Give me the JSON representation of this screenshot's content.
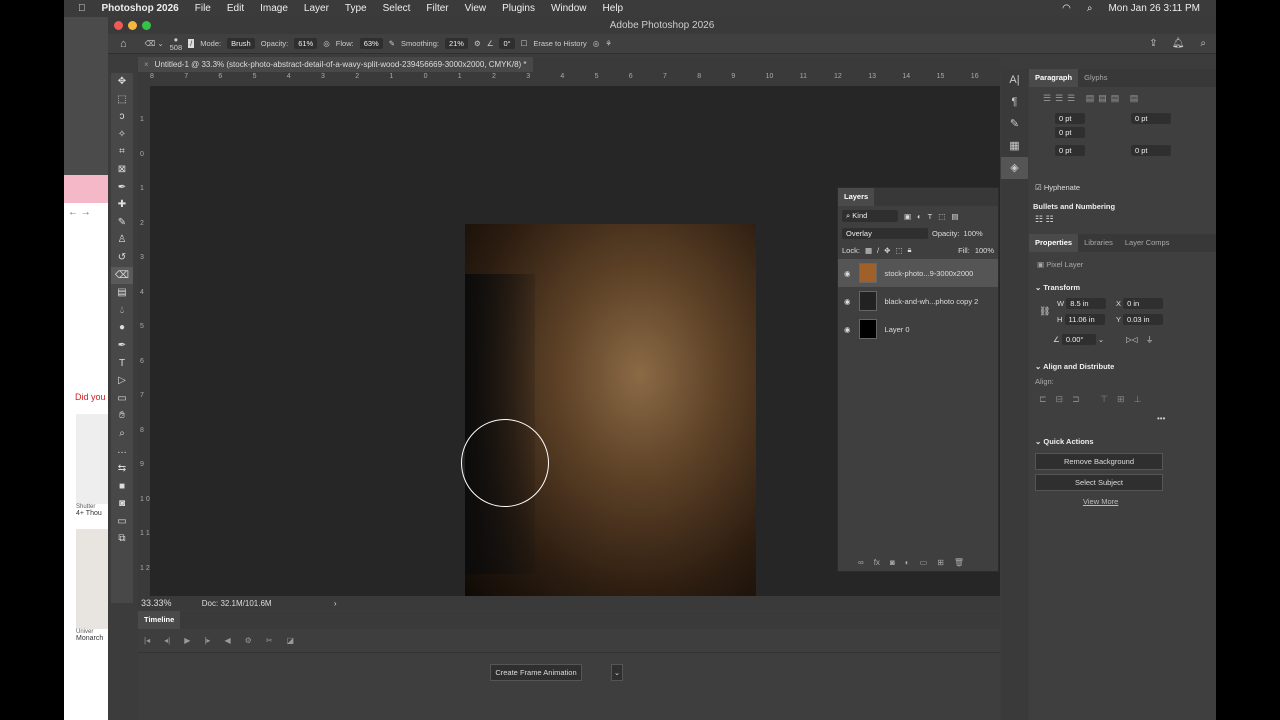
{
  "menubar": {
    "app": "Photoshop 2026",
    "items": [
      "File",
      "Edit",
      "Image",
      "Layer",
      "Type",
      "Select",
      "Filter",
      "View",
      "Plugins",
      "Window",
      "Help"
    ],
    "clock": "Mon Jan 26  3:11 PM"
  },
  "window": {
    "title": "Adobe Photoshop 2026"
  },
  "options": {
    "brush_size": "508",
    "mode_label": "Mode:",
    "mode": "Brush",
    "opacity_label": "Opacity:",
    "opacity": "61%",
    "flow_label": "Flow:",
    "flow": "63%",
    "smoothing_label": "Smoothing:",
    "smoothing": "21%",
    "angle": "0°",
    "erase_history": "Erase to History"
  },
  "document": {
    "tab": "Untitled-1 @ 33.3% (stock-photo-abstract-detail-of-a-wavy-split-wood-239456669-3000x2000, CMYK/8) *",
    "zoom": "33.33%",
    "doc_size": "Doc: 32.1M/101.6M"
  },
  "ruler": {
    "h": [
      "8",
      "7",
      "6",
      "5",
      "4",
      "3",
      "2",
      "1",
      "0",
      "1",
      "2",
      "3",
      "4",
      "5",
      "6",
      "7",
      "8",
      "9",
      "10",
      "11",
      "12",
      "13",
      "14",
      "15",
      "16"
    ],
    "v": [
      "1",
      "0",
      "1",
      "2",
      "3",
      "4",
      "5",
      "6",
      "7",
      "8",
      "9",
      "1 0",
      "1 1",
      "1 2"
    ]
  },
  "timeline": {
    "title": "Timeline",
    "create": "Create Frame Animation"
  },
  "layers": {
    "title": "Layers",
    "filter": "Kind",
    "blend": "Overlay",
    "opacity_label": "Opacity:",
    "opacity": "100%",
    "lock_label": "Lock:",
    "fill_label": "Fill:",
    "fill": "100%",
    "items": [
      {
        "name": "stock-photo...9-3000x2000",
        "selected": true
      },
      {
        "name": "black-and-wh...photo copy 2",
        "selected": false
      },
      {
        "name": "Layer 0",
        "selected": false
      }
    ]
  },
  "paragraph": {
    "tabs": [
      "Paragraph",
      "Glyphs"
    ],
    "fields": [
      "0 pt",
      "0 pt",
      "0 pt",
      "0 pt",
      "0 pt"
    ],
    "hyphenate": "Hyphenate",
    "bullets": "Bullets and Numbering"
  },
  "properties": {
    "tabs": [
      "Properties",
      "Libraries",
      "Layer Comps"
    ],
    "kind": "Pixel Layer",
    "transform": "Transform",
    "w_label": "W",
    "w": "8.5 in",
    "x_label": "X",
    "x": "0 in",
    "h_label": "H",
    "h": "11.06 in",
    "y_label": "Y",
    "y": "0.03 in",
    "angle": "0.00°",
    "align_title": "Align and Distribute",
    "align_label": "Align:",
    "quick": "Quick Actions",
    "remove_bg": "Remove Background",
    "select_subject": "Select Subject",
    "view_more": "View More"
  },
  "browser": {
    "did": "Did you",
    "src1": "Shutter",
    "count": "4+ Thou",
    "src2": "Univer",
    "name2": "Monarch"
  }
}
